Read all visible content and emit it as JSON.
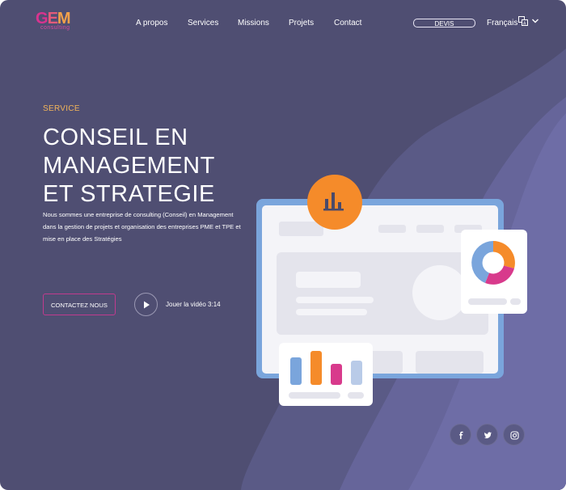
{
  "brand": {
    "mark": [
      "G",
      "E",
      "M"
    ],
    "subtitle": "consulting"
  },
  "nav": {
    "items": [
      "A propos",
      "Services",
      "Missions",
      "Projets",
      "Contact"
    ],
    "devis_label": "DEVIS",
    "language": "Français"
  },
  "hero": {
    "eyebrow": "SERVICE",
    "title_lines": [
      "CONSEIL EN",
      "MANAGEMENT",
      "ET STRATEGIE"
    ],
    "description": "Nous sommes une entreprise de consulting (Conseil) en Management dans la gestion de projets et organisation des entreprises PME et TPE et mise en place des Stratégies",
    "cta_label": "CONTACTEZ NOUS",
    "video_label": "Jouer la vidéo 3:14"
  },
  "colors": {
    "background": "#4f4e72",
    "accent_orange": "#f58b2a",
    "accent_pink": "#c13b8e",
    "eyebrow": "#f2b45a",
    "panel_blue": "#7aa5dc"
  },
  "icons": {
    "language": "translate-icon",
    "dropdown": "chevron-down-icon",
    "play": "play-icon",
    "chart_badge": "bar-chart-icon",
    "socials": [
      "facebook-icon",
      "twitter-icon",
      "instagram-icon"
    ]
  }
}
